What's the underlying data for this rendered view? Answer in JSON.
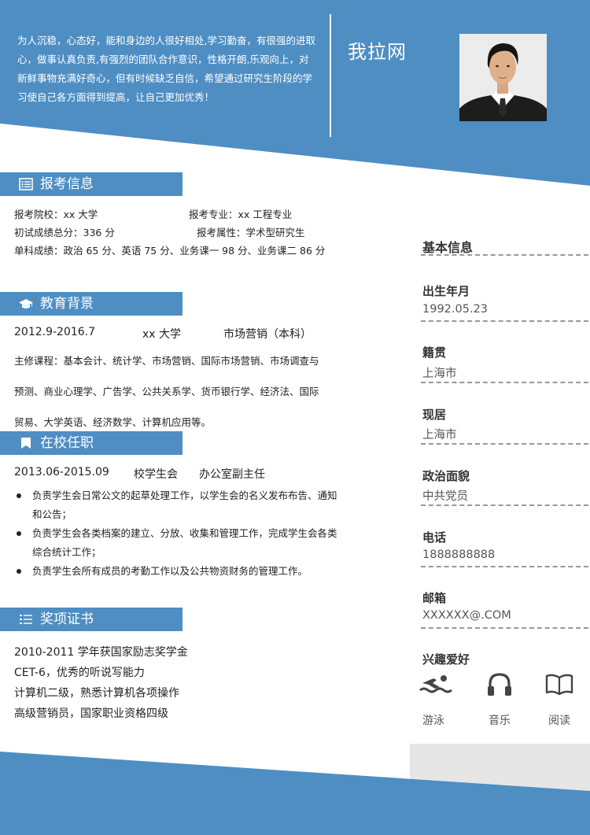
{
  "colors": {
    "primary": "#4e8ec3",
    "panel": "#e6e6e6"
  },
  "header": {
    "intro": "为人沉稳，心态好，能和身边的人很好相处,学习勤奋，有很强的进取心，做事认真负责,有强烈的团队合作意识，性格开朗,乐观向上，对新鲜事物充满好奇心，但有时候缺乏自信，希望通过研究生阶段的学习使自己各方面得到提高，让自己更加优秀！",
    "name": "我拉网"
  },
  "exam": {
    "title": "报考信息",
    "school": "报考院校：xx 大学",
    "major": "报考专业：xx 工程专业",
    "total": "初试成绩总分：336 分",
    "attr": "报考属性：学术型研究生",
    "single": "单科成绩：政治 65 分、英语 75 分、业务课一 98 分、业务课二 86 分"
  },
  "education": {
    "title": "教育背景",
    "period": "2012.9-2016.7",
    "school": "xx 大学",
    "major": "市场营销（本科）",
    "courses_1": "主修课程：基本会计、统计学、市场营销、国际市场营销、市场调查与",
    "courses_2": "预测、商业心理学、广告学、公共关系学、货币银行学、经济法、国际",
    "courses_3": "贸易、大学英语、经济数学、计算机应用等。"
  },
  "campus": {
    "title": "在校任职",
    "period": "2013.06-2015.09",
    "org": "校学生会",
    "role": "办公室副主任",
    "duties": [
      "负责学生会日常公文的起草处理工作，以学生会的名义发布布告、通知和公告；",
      "负责学生会各类档案的建立、分放、收集和管理工作，完成学生会各类综合统计工作；",
      "负责学生会所有成员的考勤工作以及公共物资财务的管理工作。"
    ]
  },
  "awards": {
    "title": "奖项证书",
    "items": [
      "2010-2011 学年获国家励志奖学金",
      "CET-6，优秀的听说写能力",
      "计算机二级，熟悉计算机各项操作",
      "高级营销员，国家职业资格四级"
    ]
  },
  "basic": {
    "title": "基本信息",
    "birth_label": "出生年月",
    "birth": "1992.05.23",
    "origin_label": "籍贯",
    "origin": "上海市",
    "residence_label": "现居",
    "residence": "上海市",
    "politics_label": "政治面貌",
    "politics": "中共党员",
    "phone_label": "电话",
    "phone": "1888888888",
    "email_label": "邮箱",
    "email": "XXXXXX@.COM",
    "hobby_label": "兴趣爱好",
    "hobbies": [
      {
        "icon": "swimming-icon",
        "label": "游泳"
      },
      {
        "icon": "headphones-icon",
        "label": "音乐"
      },
      {
        "icon": "book-icon",
        "label": "阅读"
      }
    ]
  }
}
